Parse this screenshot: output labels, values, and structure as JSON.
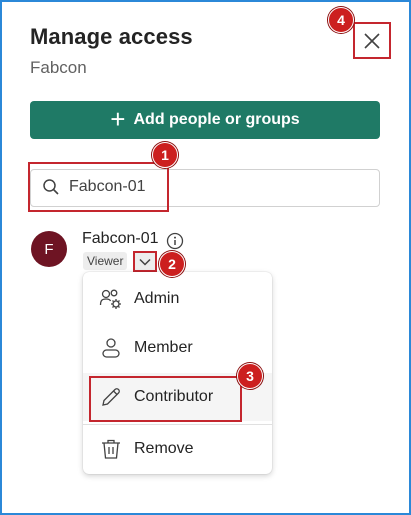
{
  "panel": {
    "title": "Manage access",
    "subtitle": "Fabcon"
  },
  "actions": {
    "add_label": "Add people or groups",
    "close_icon": "close-icon"
  },
  "search": {
    "value": "Fabcon-01"
  },
  "user": {
    "initial": "F",
    "name": "Fabcon-01",
    "role": "Viewer",
    "avatar_color": "#6e1423"
  },
  "role_menu": {
    "items": [
      {
        "label": "Admin",
        "icon": "admin-icon"
      },
      {
        "label": "Member",
        "icon": "member-icon"
      },
      {
        "label": "Contributor",
        "icon": "pencil-icon"
      },
      {
        "label": "Remove",
        "icon": "trash-icon"
      }
    ]
  },
  "annotations": {
    "badges": [
      "1",
      "2",
      "3",
      "4"
    ],
    "highlight_color": "#c4262e",
    "badge_color": "#cc1f1f"
  },
  "theme": {
    "primary_button": "#1f7a66",
    "frame_border": "#2b88d8"
  }
}
